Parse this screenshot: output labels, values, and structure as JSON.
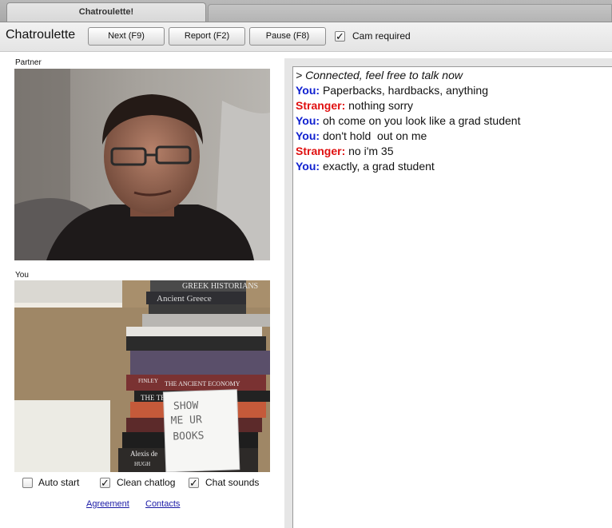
{
  "window": {
    "tab_title": "Chatroulette!"
  },
  "toolbar": {
    "app_title": "Chatroulette",
    "next_label": "Next (F9)",
    "report_label": "Report (F2)",
    "pause_label": "Pause (F8)",
    "cam_required_label": "Cam required",
    "cam_required_checked": true
  },
  "partner": {
    "label": "Partner"
  },
  "you": {
    "label": "You",
    "book_titles": [
      "GREEK HISTORIANS",
      "Ancient Greece",
      "THE ANCIENT ECONOMY",
      "FINLEY",
      "THE TER",
      "Alexis de",
      "HUGH"
    ],
    "sign_text": [
      "SHOW",
      "ME UR",
      "BOOKS"
    ]
  },
  "options": {
    "auto_start_label": "Auto start",
    "auto_start_checked": false,
    "clean_chatlog_label": "Clean chatlog",
    "clean_chatlog_checked": true,
    "chat_sounds_label": "Chat sounds",
    "chat_sounds_checked": true
  },
  "links": {
    "agreement": "Agreement",
    "contacts": "Contacts"
  },
  "chat": {
    "system_message": "> Connected, feel free to talk now",
    "messages": [
      {
        "who": "You:",
        "text": " Paperbacks, hardbacks, anything"
      },
      {
        "who": "Stranger:",
        "text": " nothing sorry"
      },
      {
        "who": "You:",
        "text": " oh come on you look like a grad student"
      },
      {
        "who": "You:",
        "text": " don't hold  out on me"
      },
      {
        "who": "Stranger:",
        "text": " no i'm 35"
      },
      {
        "who": "You:",
        "text": " exactly, a grad student"
      }
    ]
  },
  "colors": {
    "you": "#1020d0",
    "stranger": "#e01010",
    "link": "#1a1aa6"
  }
}
